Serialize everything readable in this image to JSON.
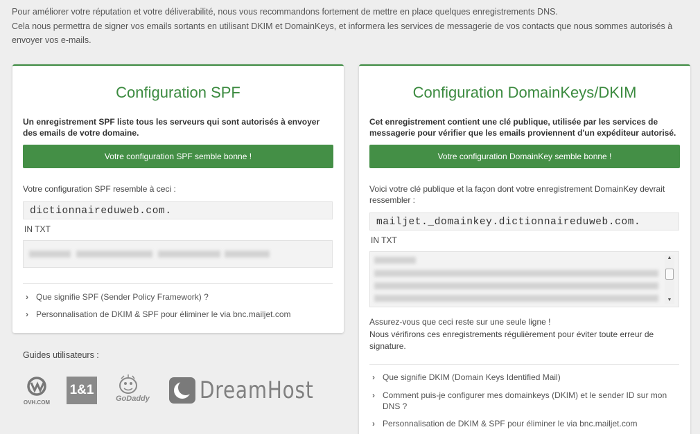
{
  "intro": {
    "line1": "Pour améliorer votre réputation et votre déliverabilité, nous vous recommandons fortement de mettre en place quelques enregistrements DNS.",
    "line2": "Cela nous permettra de signer vos emails sortants en utilisant DKIM et DomainKeys, et informera les services de messagerie de vos contacts que nous sommes autorisés à envoyer vos e-mails."
  },
  "spf": {
    "title": "Configuration SPF",
    "description": "Un enregistrement SPF liste tous les serveurs qui sont autorisés à envoyer des emails de votre domaine.",
    "status_button": "Votre configuration SPF semble bonne !",
    "config_label": "Votre configuration SPF resemble à ceci :",
    "host": "dictionnaireduweb.com.",
    "record_type": "IN TXT",
    "links": [
      "Que signifie SPF (Sender Policy Framework) ?",
      "Personnalisation de DKIM & SPF pour éliminer le via bnc.mailjet.com"
    ]
  },
  "dkim": {
    "title": "Configuration DomainKeys/DKIM",
    "description": "Cet enregistrement contient une clé publique, utilisée par les services de messagerie pour vérifier que les emails proviennent d'un expéditeur autorisé.",
    "status_button": "Votre configuration DomainKey semble bonne !",
    "config_label": "Voici votre clé publique et la façon dont votre enregistrement DomainKey devrait ressembler :",
    "host": "mailjet._domainkey.dictionnaireduweb.com.",
    "record_type": "IN TXT",
    "warning_line1": "Assurez-vous que ceci reste sur une seule ligne !",
    "warning_line2": "Nous vérifirons ces enregistrements régulièrement pour éviter toute erreur de signature.",
    "links": [
      "Que signifie DKIM (Domain Keys Identified Mail)",
      "Comment puis-je configurer mes domainkeys (DKIM) et le sender ID sur mon DNS ?",
      "Personnalisation de DKIM & SPF pour éliminer le via bnc.mailjet.com"
    ]
  },
  "guides": {
    "title": "Guides utilisateurs :",
    "ovh_label": "OVH.COM",
    "oneandone_label": "1&1",
    "godaddy_label": "GoDaddy",
    "dreamhost_label": "DreamHost"
  },
  "colors": {
    "accent": "#3b8a3f",
    "button": "#448f46",
    "background": "#eeeeee"
  }
}
